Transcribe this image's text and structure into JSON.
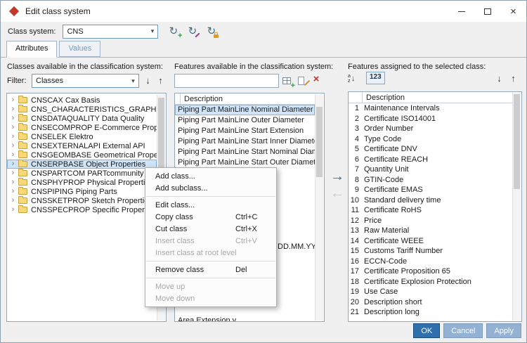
{
  "colors": {
    "accent": "#2f6fae",
    "secondary": "#93b1d3",
    "selbg": "#cfe4f7",
    "selborder": "#84b4e0",
    "tabinactive": "#6f9fc5",
    "danger": "#c0392b",
    "success": "#2f9e44",
    "panelborder": "#95a8ba"
  },
  "window": {
    "title": "Edit class system"
  },
  "icons": {
    "close": "×",
    "dropdown": "▾",
    "circle": "↻",
    "plus": "+",
    "delete": "×",
    "down": "↓",
    "up": "↑",
    "chevron": "›",
    "assign": "→",
    "unassign": "←",
    "sort_a": "a",
    "sort_z": "z"
  },
  "toolbar": {
    "class_system_label": "Class system:",
    "class_system_value": "CNS"
  },
  "tabs": [
    {
      "label": "Attributes",
      "active": true
    },
    {
      "label": "Values",
      "active": false
    }
  ],
  "left_panel": {
    "title": "Classes available in the classification system:",
    "filter_label": "Filter:",
    "filter_value": "Classes",
    "tree": [
      {
        "label": "CNSCAX Cax Basis"
      },
      {
        "label": "CNS_CHARACTERISTICS_GRAPH Characte..."
      },
      {
        "label": "CNSDATAQUALITY Data Quality"
      },
      {
        "label": "CNSECOMPROP E-Commerce Properties"
      },
      {
        "label": "CNSELEK Elektro"
      },
      {
        "label": "CNSEXTERNALAPI External API"
      },
      {
        "label": "CNSGEOMBASE Geometrical Properties"
      },
      {
        "label": "CNSERPBASE Object Properties",
        "selected": true
      },
      {
        "label": "CNSPARTCOM PARTcommunity"
      },
      {
        "label": "CNSPHYPROP Physical Properties"
      },
      {
        "label": "CNSPIPING Piping Parts"
      },
      {
        "label": "CNSSKETPROP Sketch Properties"
      },
      {
        "label": "CNSSPECPROP Specific Properties"
      }
    ]
  },
  "middle_panel": {
    "title": "Features available in the classification system:",
    "search_value": "",
    "list_header": "Description",
    "rows": [
      {
        "index": 0,
        "text": "Piping Part MainLine Nominal Diameter",
        "selected": true
      },
      {
        "index": 1,
        "text": "Piping Part MainLine Outer Diameter"
      },
      {
        "index": 2,
        "text": "Piping Part MainLine Start Extension"
      },
      {
        "index": 3,
        "text": "Piping Part MainLine Start Inner Diameter"
      },
      {
        "index": 4,
        "text": "Piping Part MainLine Start Nominal Diameter"
      },
      {
        "index": 5,
        "text": "Piping Part MainLine Start Outer Diameter"
      },
      {
        "index": 13,
        "text": "DD.MM.YYYY)",
        "offset_fragment": true
      },
      {
        "index": 20,
        "text": "Area Extension v"
      }
    ]
  },
  "right_panel": {
    "title": "Features assigned to the selected class:",
    "numbers_toggle": "123",
    "table_header": "Description",
    "rows": [
      "Maintenance Intervals",
      "Certificate ISO14001",
      "Order Number",
      "Type Code",
      "Certificate DNV",
      "Certificate REACH",
      "Quantity Unit",
      "GTIN-Code",
      "Certificate EMAS",
      "Standard delivery time",
      "Certificate RoHS",
      "Price",
      "Raw Material",
      "Certificate WEEE",
      "Customs Tariff Number",
      "ECCN-Code",
      "Certificate Proposition 65",
      "Certificate Explosion Protection",
      "Use Case",
      "Description short",
      "Description long"
    ]
  },
  "context_menu": {
    "items": [
      {
        "label": "Add class..."
      },
      {
        "label": "Add subclass..."
      },
      {
        "type": "separator"
      },
      {
        "label": "Edit class..."
      },
      {
        "label": "Copy class",
        "shortcut": "Ctrl+C"
      },
      {
        "label": "Cut class",
        "shortcut": "Ctrl+X"
      },
      {
        "label": "Insert class",
        "shortcut": "Ctrl+V",
        "disabled": true
      },
      {
        "label": "Insert class at root level",
        "disabled": true
      },
      {
        "type": "separator"
      },
      {
        "label": "Remove class",
        "shortcut": "Del"
      },
      {
        "type": "separator"
      },
      {
        "label": "Move up",
        "disabled": true
      },
      {
        "label": "Move down",
        "disabled": true
      }
    ]
  },
  "footer": {
    "ok": "OK",
    "cancel": "Cancel",
    "apply": "Apply"
  }
}
